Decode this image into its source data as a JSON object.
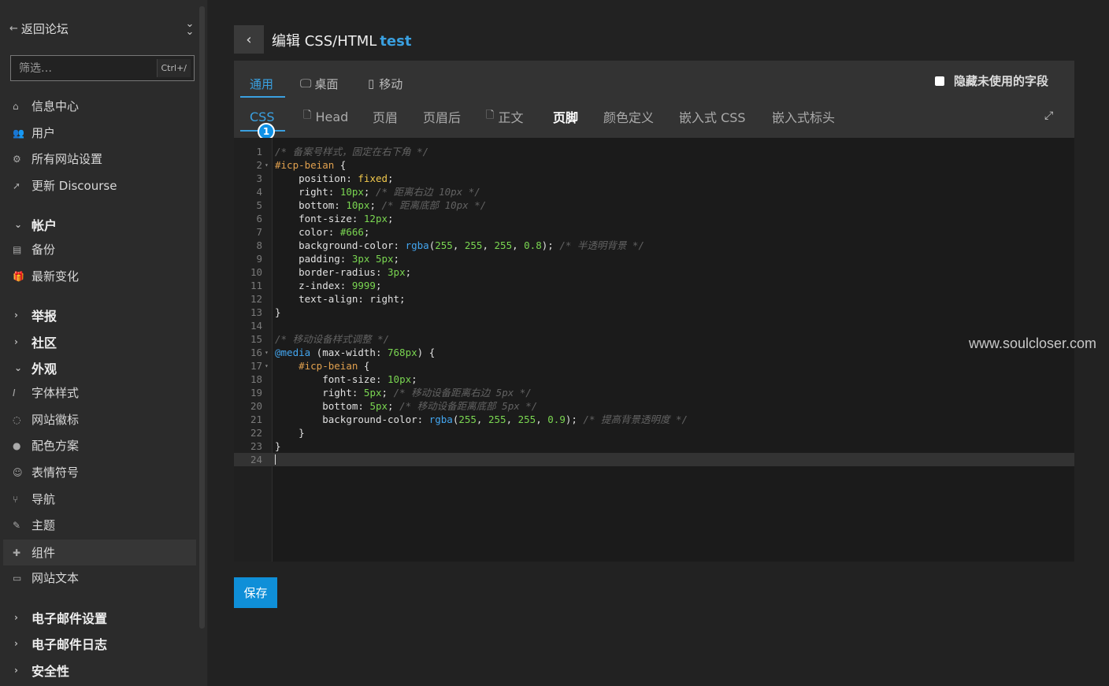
{
  "sidebar": {
    "back_label": "返回论坛",
    "filter_placeholder": "筛选…",
    "filter_shortcut": "Ctrl+/",
    "top_items": [
      {
        "icon": "house-icon",
        "label": "信息中心"
      },
      {
        "icon": "users-icon",
        "label": "用户"
      },
      {
        "icon": "gear-icon",
        "label": "所有网站设置"
      },
      {
        "icon": "rocket-icon",
        "label": "更新 Discourse"
      }
    ],
    "account": {
      "title": "帐户",
      "items": [
        {
          "icon": "archive-icon",
          "label": "备份"
        },
        {
          "icon": "gift-icon",
          "label": "最新变化"
        }
      ]
    },
    "report_title": "举报",
    "community_title": "社区",
    "appearance": {
      "title": "外观",
      "items": [
        {
          "icon": "italic-icon",
          "label": "字体样式"
        },
        {
          "icon": "badge-icon",
          "label": "网站徽标"
        },
        {
          "icon": "palette-icon",
          "label": "配色方案"
        },
        {
          "icon": "emoji-icon",
          "label": "表情符号"
        },
        {
          "icon": "navigation-icon",
          "label": "导航"
        },
        {
          "icon": "brush-icon",
          "label": "主题"
        },
        {
          "icon": "puzzle-icon",
          "label": "组件"
        },
        {
          "icon": "text-icon",
          "label": "网站文本"
        }
      ],
      "active_index": 6
    },
    "email_settings_title": "电子邮件设置",
    "email_logs_title": "电子邮件日志",
    "security_title": "安全性"
  },
  "header": {
    "title_prefix": "编辑 CSS/HTML",
    "title_accent": "test"
  },
  "tabs_top": [
    {
      "label": "通用",
      "icon": "",
      "active": true
    },
    {
      "label": "桌面",
      "icon": "desktop-icon",
      "active": false
    },
    {
      "label": "移动",
      "icon": "mobile-icon",
      "active": false
    }
  ],
  "hide_unused_label": "隐藏未使用的字段",
  "tabs_sub": [
    {
      "label": "CSS",
      "icon": "",
      "active": true
    },
    {
      "label": "Head",
      "icon": "file-icon"
    },
    {
      "label": "页眉"
    },
    {
      "label": "页眉后"
    },
    {
      "label": "正文",
      "icon": "file-icon"
    },
    {
      "label": "页脚",
      "bold": true
    },
    {
      "label": "颜色定义"
    },
    {
      "label": "嵌入式 CSS"
    },
    {
      "label": "嵌入式标头"
    }
  ],
  "css_badge": "1",
  "editor": {
    "lines": [
      "/* 备案号样式，固定在右下角 */",
      "#icp-beian {",
      "    position: fixed;",
      "    right: 10px; /* 距离右边 10px */",
      "    bottom: 10px; /* 距离底部 10px */",
      "    font-size: 12px;",
      "    color: #666;",
      "    background-color: rgba(255, 255, 255, 0.8); /* 半透明背景 */",
      "    padding: 3px 5px;",
      "    border-radius: 3px;",
      "    z-index: 9999;",
      "    text-align: right;",
      "}",
      "",
      "/* 移动设备样式调整 */",
      "@media (max-width: 768px) {",
      "    #icp-beian {",
      "        font-size: 10px;",
      "        right: 5px; /* 移动设备距离右边 5px */",
      "        bottom: 5px; /* 移动设备距离底部 5px */",
      "        background-color: rgba(255, 255, 255, 0.9); /* 提高背景透明度 */",
      "    }",
      "}",
      ""
    ],
    "fold_lines": [
      2,
      16,
      17
    ],
    "current_line": 24
  },
  "watermark": "www.soulcloser.com",
  "save_label": "保存",
  "colors": {
    "accent": "#3aa0e0",
    "save_bg": "#0f8fd8",
    "badge_bg": "#0f91e6"
  }
}
